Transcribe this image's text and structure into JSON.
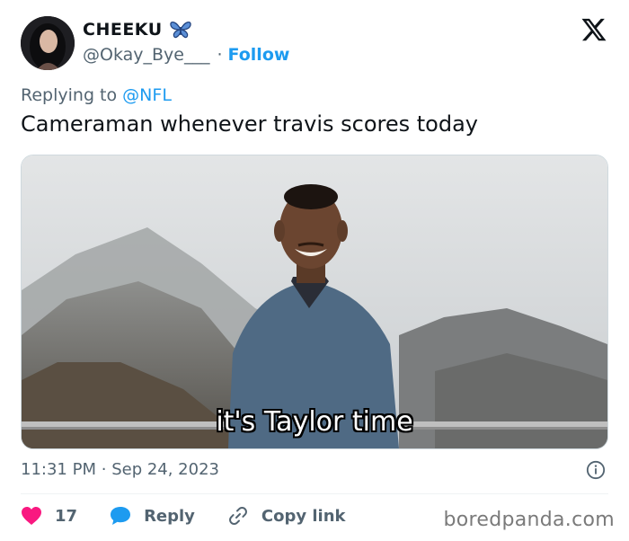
{
  "author": {
    "display_name": "CHEEKU",
    "handle": "@Okay_Bye___",
    "follow_label": "Follow",
    "separator": "·",
    "badge_icon": "butterfly-emoji-icon"
  },
  "reply_context": {
    "prefix": "Replying to",
    "mention": "@NFL"
  },
  "tweet": {
    "text": "Cameraman whenever travis scores today",
    "media_caption": "it's Taylor time",
    "time": "11:31 PM",
    "date_separator": "·",
    "date": "Sep 24, 2023"
  },
  "actions": {
    "like_count": "17",
    "reply_label": "Reply",
    "copy_label": "Copy link"
  },
  "icons": {
    "platform": "x-logo-icon",
    "info": "info-icon",
    "like": "heart-icon",
    "reply": "speech-bubble-icon",
    "copy": "link-icon"
  },
  "colors": {
    "accent": "#1d9bf0",
    "like": "#f91880",
    "text": "#0f1419",
    "muted": "#536471"
  },
  "watermark": "boredpanda.com"
}
